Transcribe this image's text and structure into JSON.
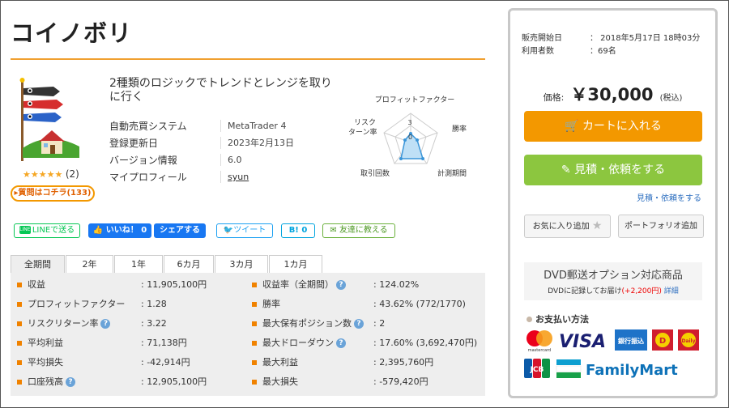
{
  "product": {
    "title": "コイノボリ",
    "description": "2種類のロジックでトレンドとレンジを取りに行く",
    "rating_stars": "★★★★★",
    "rating_count": "(2)",
    "qa_label": "▸質問はコチラ(133)"
  },
  "info": [
    {
      "key": "自動売買システム",
      "value": "MetaTrader 4"
    },
    {
      "key": "登録更新日",
      "value": "2023年2月13日"
    },
    {
      "key": "バージョン情報",
      "value": "6.0"
    },
    {
      "key": "マイプロフィール",
      "value": "syun"
    }
  ],
  "radar": {
    "labels": [
      "プロフィットファクター",
      "勝率",
      "計測期間",
      "取引回数",
      "リスク\nターン率"
    ],
    "label_pf": "プロフィットファクター",
    "label_win": "勝率",
    "label_period": "計測期間",
    "label_trades": "取引回数",
    "label_risk1": "リスク",
    "label_risk2": "ターン率",
    "scale_max": "3",
    "scale_min": "0"
  },
  "social": {
    "line": "LINEで送る",
    "line_icon": "LINE",
    "fb_like": "いいね！ 0",
    "fb_share": "シェアする",
    "tweet": "ツイート",
    "hatena": "B! 0",
    "mail": "友達に教える"
  },
  "tabs": [
    "全期間",
    "2年",
    "1年",
    "6カ月",
    "3カ月",
    "1カ月"
  ],
  "stats_left": [
    {
      "key": "収益",
      "value": ": 11,905,100円"
    },
    {
      "key": "プロフィットファクター",
      "value": ": 1.28"
    },
    {
      "key": "リスクリターン率",
      "value": ": 3.22",
      "help": true
    },
    {
      "key": "平均利益",
      "value": ": 71,138円"
    },
    {
      "key": "平均損失",
      "value": ": -42,914円"
    },
    {
      "key": "口座残高",
      "value": ": 12,905,100円",
      "help": true
    }
  ],
  "stats_right": [
    {
      "key": "収益率（全期間）",
      "value": ": 124.02%",
      "help": true
    },
    {
      "key": "勝率",
      "value": ": 43.62% (772/1770)"
    },
    {
      "key": "最大保有ポジション数",
      "value": ": 2",
      "help": true
    },
    {
      "key": "最大ドローダウン",
      "value": ": 17.60% (3,692,470円)",
      "help": true
    },
    {
      "key": "最大利益",
      "value": ": 2,395,760円"
    },
    {
      "key": "最大損失",
      "value": ": -579,420円"
    }
  ],
  "help_glyph": "?",
  "side": {
    "sale_start_label": "販売開始日",
    "sale_start_value": "：  2018年5月17日 18時03分",
    "users_label": "利用者数",
    "users_value": "：69名",
    "price_label": "価格:",
    "price_value": "￥30,000",
    "price_tax": "(税込)",
    "cart_label": "カートに入れる",
    "estimate_label": "見積・依頼をする",
    "estimate_link": "見積・依頼をする",
    "fav_label": "お気に入り追加",
    "portfolio_label": "ポートフォリオ追加",
    "dvd_title": "DVD郵送オプション対応商品",
    "dvd_note": "DVDに記録してお届け",
    "dvd_price": "(+2,200円)",
    "dvd_link": "詳細",
    "payment_title": "お支払い方法",
    "pay_mastercard": "mastercard",
    "pay_visa": "VISA",
    "pay_bank": "銀行振込",
    "pay_daily1": "D",
    "pay_daily2": "Daily",
    "pay_jcb": "JCB",
    "pay_familymart": "FamilyMart"
  },
  "colors": {
    "accent_orange": "#f39800",
    "green_button": "#8cc63f",
    "link_blue": "#2f70c0"
  }
}
